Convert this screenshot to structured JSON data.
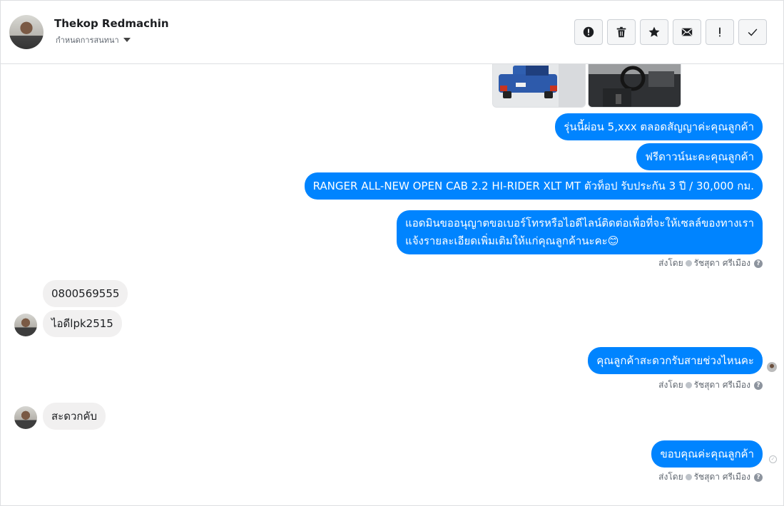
{
  "header": {
    "name": "Thekop Redmachin",
    "subtitle": "กำหนดการสนทนา",
    "actions": [
      {
        "name": "spam-button",
        "icon": "alert-circle-icon"
      },
      {
        "name": "delete-button",
        "icon": "trash-icon"
      },
      {
        "name": "star-button",
        "icon": "star-icon"
      },
      {
        "name": "mark-unread-button",
        "icon": "envelope-icon"
      },
      {
        "name": "follow-up-button",
        "icon": "exclamation-icon"
      },
      {
        "name": "mark-done-button",
        "icon": "checkmark-icon"
      }
    ]
  },
  "messages": {
    "out1": "รุ่นนี้ผ่อน 5,xxx ตลอดสัญญาค่ะคุณลูกค้า",
    "out2": "ฟรีดาวน์นะคะคุณลูกค้า",
    "out3": "RANGER ALL-NEW OPEN CAB 2.2 HI-RIDER XLT MT ตัวท็อป รับประกัน 3 ปี / 30,000 กม.",
    "out4_line1": "แอดมินขออนุญาตขอเบอร์โทรหรือไอดีไลน์ติดต่อเพื่อที่จะให้เซลล์ของทางเรา",
    "out4_line2": "แจ้งรายละเอียดเพิ่มเติมให้แก่คุณลูกค้านะคะ😊",
    "in1": "0800569555",
    "in2": "ไอดีlpk2515",
    "out5": "คุณลูกค้าสะดวกรับสายช่วงไหนคะ",
    "in3": "สะดวกคับ",
    "out6": "ขอบคุณค่ะคุณลูกค้า"
  },
  "sent_by": {
    "prefix": "ส่งโดย",
    "agent": "รัชสุดา ศรีเมือง",
    "help": "?"
  },
  "colors": {
    "outgoing": "#0084ff",
    "incoming": "#f1f0f0"
  }
}
